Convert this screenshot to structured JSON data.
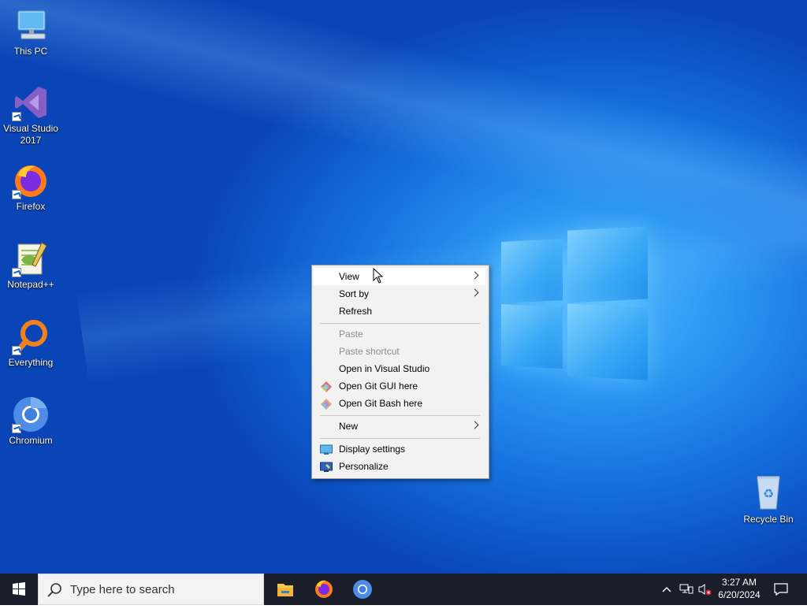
{
  "desktop": {
    "icons": [
      {
        "label": "This PC"
      },
      {
        "label": "Visual Studio 2017"
      },
      {
        "label": "Firefox"
      },
      {
        "label": "Notepad++"
      },
      {
        "label": "Everything"
      },
      {
        "label": "Chromium"
      },
      {
        "label": "Recycle Bin"
      }
    ]
  },
  "context_menu": {
    "items": [
      {
        "label": "View",
        "submenu": true
      },
      {
        "label": "Sort by",
        "submenu": true
      },
      {
        "label": "Refresh"
      },
      {
        "label": "Paste",
        "disabled": true
      },
      {
        "label": "Paste shortcut",
        "disabled": true
      },
      {
        "label": "Open in Visual Studio"
      },
      {
        "label": "Open Git GUI here",
        "icon": "git-gui-icon"
      },
      {
        "label": "Open Git Bash here",
        "icon": "git-bash-icon"
      },
      {
        "label": "New",
        "submenu": true
      },
      {
        "label": "Display settings",
        "icon": "display-icon"
      },
      {
        "label": "Personalize",
        "icon": "personalize-icon"
      }
    ]
  },
  "taskbar": {
    "search_placeholder": "Type here to search",
    "pinned": [
      "file-explorer-icon",
      "firefox-icon",
      "chromium-icon"
    ],
    "clock": {
      "time": "3:27 AM",
      "date": "6/20/2024"
    }
  },
  "colors": {
    "taskbar_bg": "#1a1e2b",
    "desktop_accent": "#1673e0",
    "menu_bg": "#f2f2f2"
  }
}
